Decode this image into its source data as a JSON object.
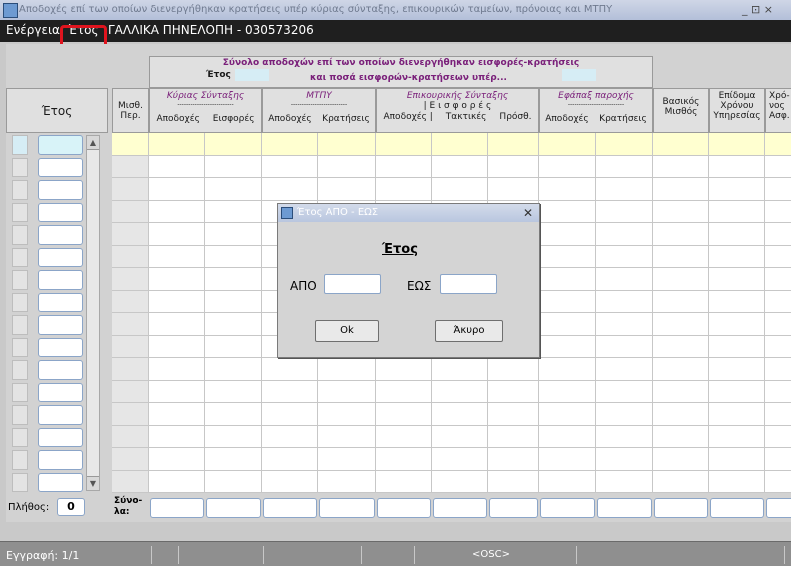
{
  "window": {
    "title": "Αποδοχές επί των οποίων διενεργήθηκαν κρατήσεις υπέρ κύριας σύνταξης, επικουρικών ταμείων, πρόνοιας και ΜΤΠΥ",
    "controls": "_ ⊡ ×"
  },
  "menu": {
    "items": [
      "Ενέργεια",
      "Έτος"
    ],
    "record_title": "ΓΑΛΛΙΚΑ ΠΗΝΕΛΟΠΗ - 030573206"
  },
  "header": {
    "summary_line1": "Σύνολο αποδοχών επί των οποίων διενεργήθηκαν εισφορές-κρατήσεις",
    "summary_line2": "και ποσά εισφορών-κρατήσεων υπέρ...",
    "year_label": "Έτος",
    "col_year": "Έτος",
    "col_misth": "Μισθ.\nΠερ.",
    "group_kyrias": "Κύριας Σύνταξης",
    "group_mtpy": "ΜΤΠΥ",
    "group_epik": "Επικουρικής Σύνταξης",
    "group_efapax": "Εφάπαξ παροχής",
    "dashes": "--------------------------",
    "eisfores_spaced": "|  Ε ι σ φ ο ρ έ ς",
    "sub_apodoxes": "Αποδοχές",
    "sub_eisfores": "Εισφορές",
    "sub_kratiseis": "Κρατήσεις",
    "sub_apodoxes_bar": "Αποδοχές |",
    "sub_taktikes": "Τακτικές",
    "sub_prosth": "Πρόσθ.",
    "col_vasikos": "Βασικός\nΜισθός",
    "col_epidoma": "Επίδομα\nΧρόνου\nΥπηρεσίας",
    "col_xrono": "Χρό-\nνος\nΑσφ."
  },
  "footer": {
    "plithos_label": "Πλήθος:",
    "plithos_value": "0",
    "synola_label": "Σύνο-\nλα:"
  },
  "dialog": {
    "title": "Έτος ΑΠΟ - ΕΩΣ",
    "heading": "Έτος",
    "from_label": "ΑΠΟ",
    "to_label": "ΕΩΣ",
    "from_value": "",
    "to_value": "",
    "ok_label": "Ok",
    "cancel_label": "Άκυρο",
    "close": "✕"
  },
  "status": {
    "record": "Εγγραφή: 1/1",
    "osc": "<OSC>"
  }
}
